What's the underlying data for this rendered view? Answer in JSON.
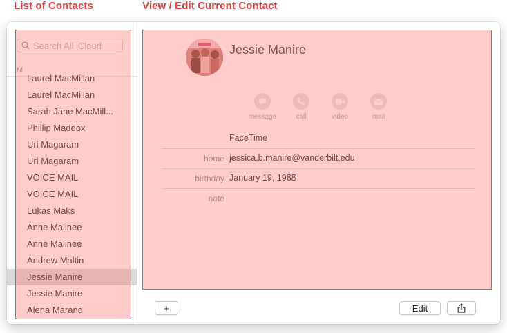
{
  "annotations": {
    "left": "List of Contacts",
    "right": "View / Edit Current Contact"
  },
  "sidebar": {
    "search_placeholder": "Search All iCloud",
    "section_letter": "M",
    "contacts": [
      {
        "name": "Laurel MacMillan"
      },
      {
        "name": "Laurel MacMillan"
      },
      {
        "name": "Sarah Jane MacMill..."
      },
      {
        "name": "Phillip Maddox"
      },
      {
        "name": "Uri Magaram"
      },
      {
        "name": "Uri Magaram"
      },
      {
        "name": "VOICE MAIL"
      },
      {
        "name": "VOICE MAIL"
      },
      {
        "name": "Lukas Mäks"
      },
      {
        "name": "Anne Malinee"
      },
      {
        "name": "Anne Malinee"
      },
      {
        "name": "Andrew Maltin"
      },
      {
        "name": "Jessie Manire",
        "selected": true
      },
      {
        "name": "Jessie Manire"
      },
      {
        "name": "Alena Marand"
      }
    ]
  },
  "detail": {
    "name": "Jessie Manire",
    "actions": [
      {
        "label": "message",
        "icon": "message-icon"
      },
      {
        "label": "call",
        "icon": "phone-icon"
      },
      {
        "label": "video",
        "icon": "video-icon"
      },
      {
        "label": "mail",
        "icon": "mail-icon"
      }
    ],
    "facetime_label": "FaceTime",
    "fields": [
      {
        "label": "home",
        "value": "jessica.b.manire@vanderbilt.edu"
      },
      {
        "label": "birthday",
        "value": "January 19, 1988"
      },
      {
        "label": "note",
        "value": ""
      }
    ]
  },
  "toolbar": {
    "add_label": "+",
    "edit_label": "Edit",
    "share_icon": "share-icon"
  },
  "colors": {
    "annotation": "#e2403f",
    "overlay": "#ff7878",
    "selected_row": "#d9d9d9"
  }
}
